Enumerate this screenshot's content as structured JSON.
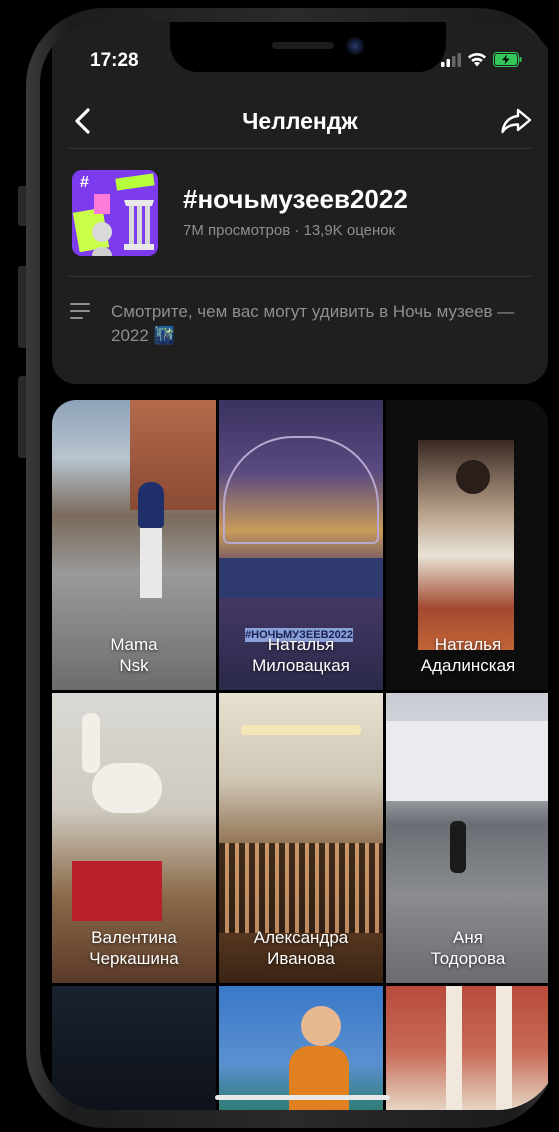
{
  "status_bar": {
    "time": "17:28"
  },
  "nav": {
    "title": "Челлендж"
  },
  "challenge": {
    "hashtag": "#ночьмузеев2022",
    "stats": "7M просмотров · 13,9K оценок",
    "description": "Смотрите, чем вас могут удивить в Ночь музеев — 2022 🌃",
    "cover_text": "#"
  },
  "videos": [
    {
      "line1": "Mama",
      "line2": "Nsk",
      "tag": ""
    },
    {
      "line1": "Наталья",
      "line2": "Миловацкая",
      "tag": "#НОЧЬМУЗЕЕВ2022"
    },
    {
      "line1": "Наталья",
      "line2": "Адалинская",
      "tag": ""
    },
    {
      "line1": "Валентина",
      "line2": "Черкашина",
      "tag": ""
    },
    {
      "line1": "Александра",
      "line2": "Иванова",
      "tag": ""
    },
    {
      "line1": "Аня",
      "line2": "Тодорова",
      "tag": ""
    },
    {
      "line1": "",
      "line2": "",
      "tag": ""
    },
    {
      "line1": "",
      "line2": "",
      "tag": ""
    },
    {
      "line1": "",
      "line2": "",
      "tag": ""
    }
  ],
  "colors": {
    "panel": "#1f1f1f",
    "muted_text": "#8e8e93",
    "battery": "#34c759"
  }
}
